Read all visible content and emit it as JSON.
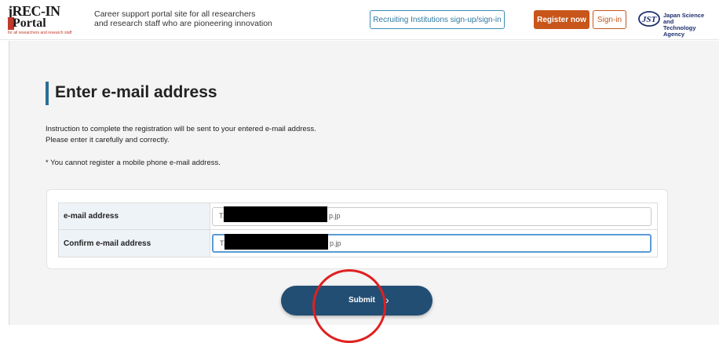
{
  "header": {
    "logo": {
      "line1": "jREC-IN",
      "line2": "Portal",
      "small": "for all researchers and research staff"
    },
    "tagline_line1": "Career support portal site for all researchers",
    "tagline_line2": "and research staff who are pioneering innovation",
    "institutions_button": "Recruiting Institutions sign-up/sign-in",
    "register_button": "Register now",
    "signin_button": "Sign-in",
    "jst": {
      "mark": "JST",
      "line1": "Japan Science and",
      "line2": "Technology Agency"
    }
  },
  "main": {
    "title": "Enter e-mail address",
    "instruction_line1": "Instruction to complete the registration will be sent to your entered e-mail address.",
    "instruction_line2": "Please enter it carefully and correctly.",
    "note": "* You cannot register a mobile phone e-mail address.",
    "form": {
      "email_label": "e-mail address",
      "email_prefix": "T/",
      "email_suffix": "p.jp",
      "confirm_label": "Confirm e-mail address",
      "confirm_prefix": "T/",
      "confirm_suffix": "p.jp"
    },
    "submit_label": "Submit",
    "submit_arrow": "›"
  },
  "colors": {
    "accent": "#2a6f96",
    "register": "#c8551a",
    "submit": "#234e73",
    "highlight_circle": "#e02020"
  }
}
